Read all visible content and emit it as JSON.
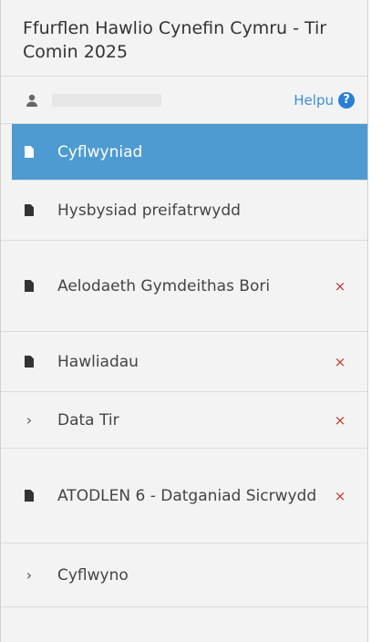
{
  "header": {
    "title": "Ffurflen Hawlio Cynefin Cymru - Tir Comin 2025"
  },
  "userbar": {
    "help_label": "Helpu",
    "help_icon": "question-circle-icon"
  },
  "nav": {
    "items": [
      {
        "label": "Cyflwyniad",
        "icon": "document-icon",
        "active": true
      },
      {
        "label": "Hysbysiad preifatrwydd",
        "icon": "document-icon"
      },
      {
        "label": "Aelodaeth Gymdeithas Bori",
        "icon": "document-icon",
        "remove": "×"
      },
      {
        "label": "Hawliadau",
        "icon": "document-icon",
        "remove": "×"
      },
      {
        "label": "Data Tir",
        "icon": "chevron-right-icon",
        "remove": "×"
      },
      {
        "label": "ATODLEN 6 - Datganiad Sicrwydd",
        "icon": "document-icon",
        "remove": "×"
      },
      {
        "label": "Cyflwyno",
        "icon": "chevron-right-icon"
      }
    ]
  },
  "colors": {
    "active_bg": "#4e9bd1",
    "remove": "#c0392b",
    "help": "#3a8fd9"
  }
}
